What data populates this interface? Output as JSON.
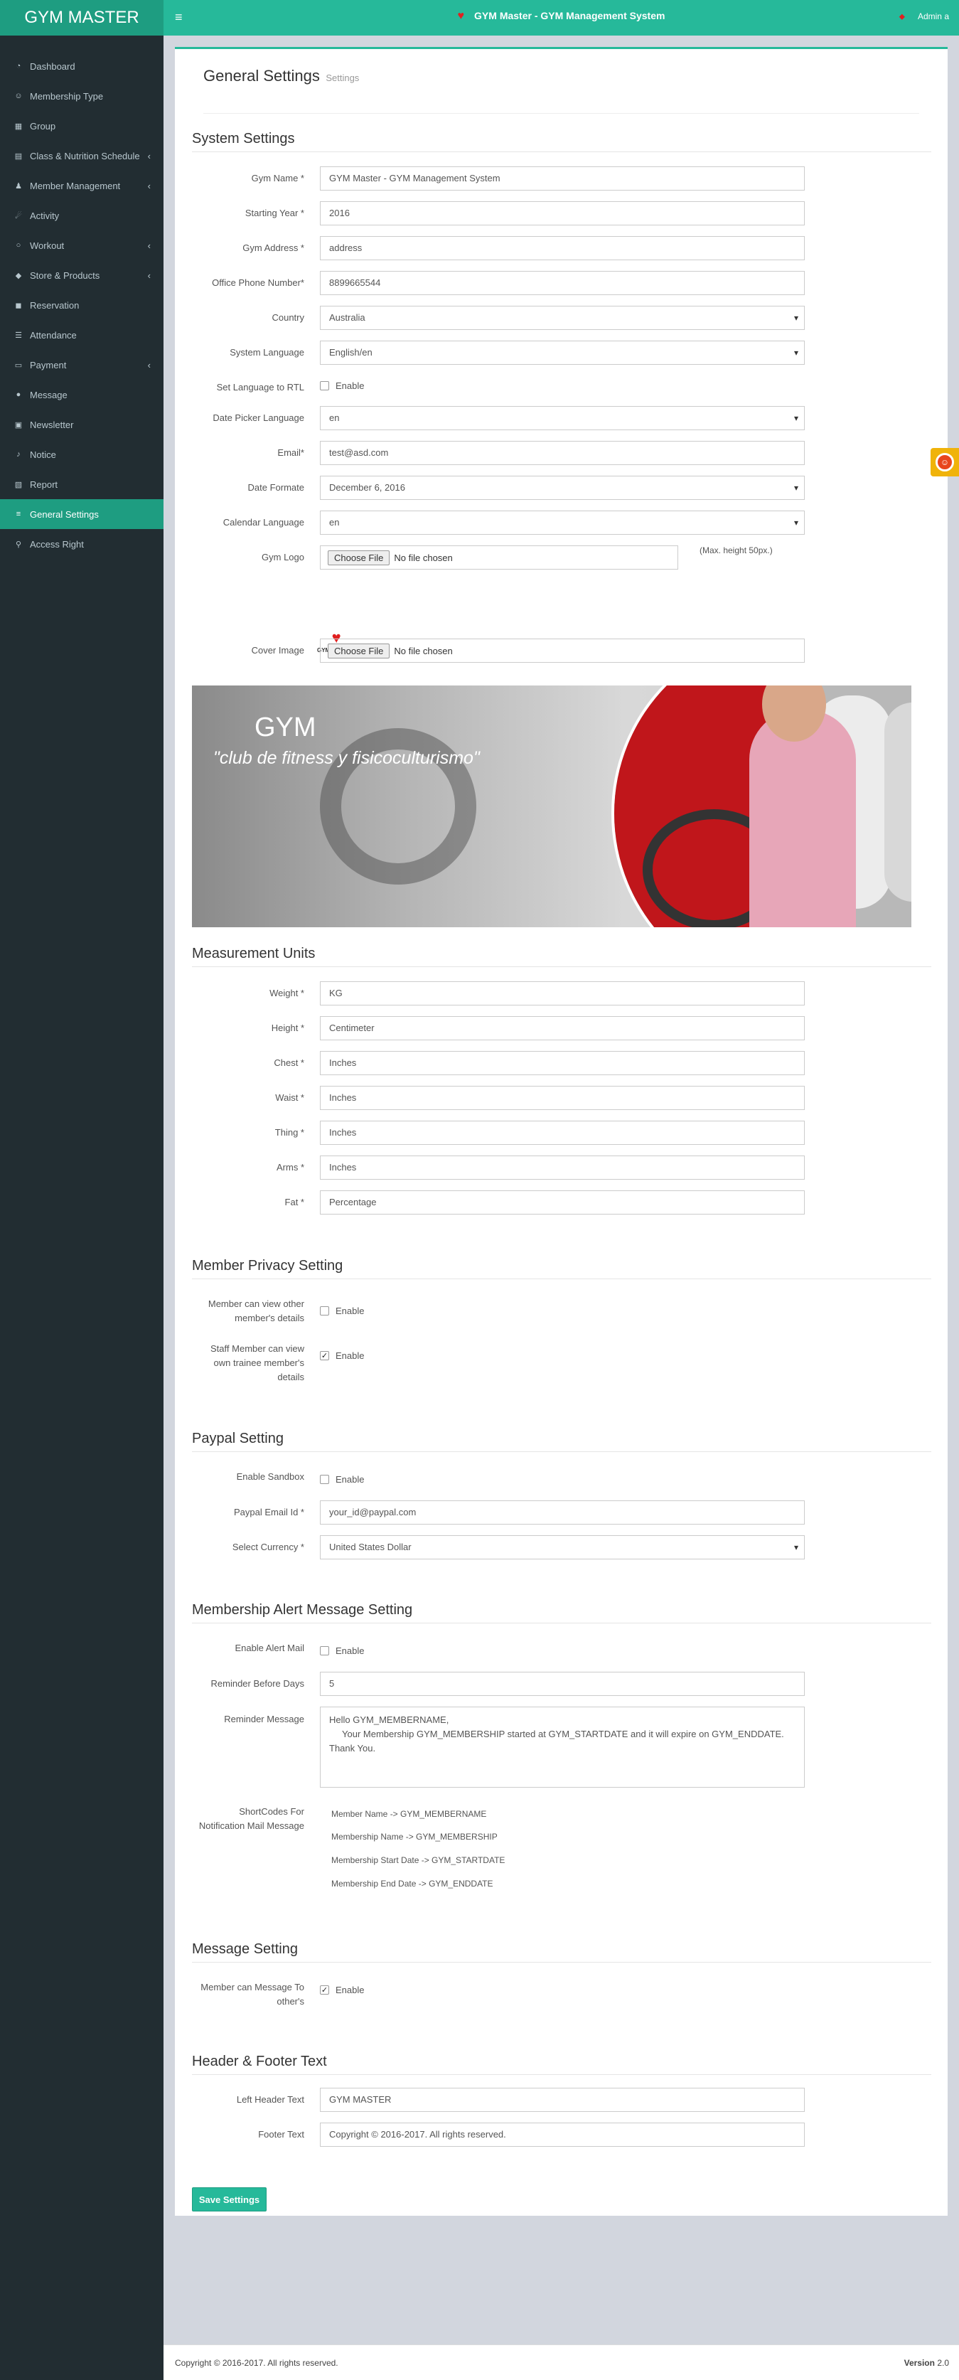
{
  "app": {
    "logo": "GYM MASTER",
    "title": "GYM Master - GYM Management System",
    "user": "Admin a"
  },
  "sidebar": {
    "items": [
      {
        "label": "Dashboard",
        "icon": "dashboard-icon"
      },
      {
        "label": "Membership Type",
        "icon": "users-icon"
      },
      {
        "label": "Group",
        "icon": "group-icon"
      },
      {
        "label": "Class & Nutrition Schedule",
        "icon": "calendar-icon",
        "chevron": true
      },
      {
        "label": "Member Management",
        "icon": "user-icon",
        "chevron": true
      },
      {
        "label": "Activity",
        "icon": "activity-icon"
      },
      {
        "label": "Workout",
        "icon": "workout-icon",
        "chevron": true
      },
      {
        "label": "Store & Products",
        "icon": "tag-icon",
        "chevron": true
      },
      {
        "label": "Reservation",
        "icon": "reservation-icon"
      },
      {
        "label": "Attendance",
        "icon": "attendance-icon"
      },
      {
        "label": "Payment",
        "icon": "payment-icon",
        "chevron": true
      },
      {
        "label": "Message",
        "icon": "message-icon"
      },
      {
        "label": "Newsletter",
        "icon": "newsletter-icon"
      },
      {
        "label": "Notice",
        "icon": "bell-icon"
      },
      {
        "label": "Report",
        "icon": "report-icon"
      },
      {
        "label": "General Settings",
        "icon": "settings-icon",
        "active": true
      },
      {
        "label": "Access Right",
        "icon": "key-icon"
      }
    ]
  },
  "page": {
    "title": "General Settings",
    "subtitle": "Settings"
  },
  "system": {
    "title": "System Settings",
    "gym_name_label": "Gym Name *",
    "gym_name": "GYM Master - GYM Management System",
    "year_label": "Starting Year *",
    "year": "2016",
    "address_label": "Gym Address *",
    "address": "address",
    "phone_label": "Office Phone Number*",
    "phone": "8899665544",
    "country_label": "Country",
    "country": "Australia",
    "lang_label": "System Language",
    "lang": "English/en",
    "rtl_label": "Set Language to RTL",
    "rtl_value": "Enable",
    "datepicker_label": "Date Picker Language",
    "datepicker": "en",
    "email_label": "Email*",
    "email": "test@asd.com",
    "dateformat_label": "Date Formate",
    "dateformat": "December 6, 2016",
    "calendar_label": "Calendar Language",
    "calendar": "en",
    "logo_label": "Gym Logo",
    "choose_file": "Choose File",
    "no_file": "No file chosen",
    "logo_hint": "(Max. height 50px.)",
    "logo_text": "GYM MASTER",
    "cover_label": "Cover Image",
    "banner_title": "GYM",
    "banner_tagline": "\"club de fitness y fisicoculturismo\""
  },
  "measurement": {
    "title": "Measurement Units",
    "rows": [
      {
        "label": "Weight *",
        "value": "KG"
      },
      {
        "label": "Height *",
        "value": "Centimeter"
      },
      {
        "label": "Chest *",
        "value": "Inches"
      },
      {
        "label": "Waist *",
        "value": "Inches"
      },
      {
        "label": "Thing *",
        "value": "Inches"
      },
      {
        "label": "Arms *",
        "value": "Inches"
      },
      {
        "label": "Fat *",
        "value": "Percentage"
      }
    ]
  },
  "privacy": {
    "title": "Member Privacy Setting",
    "member_view_label": "Member can view other member's details",
    "member_view": "Enable",
    "staff_view_label": "Staff Member can view own trainee member's details",
    "staff_view": "Enable"
  },
  "paypal": {
    "title": "Paypal Setting",
    "sandbox_label": "Enable Sandbox",
    "sandbox": "Enable",
    "email_label": "Paypal Email Id *",
    "email": "your_id@paypal.com",
    "currency_label": "Select Currency *",
    "currency": "United States Dollar"
  },
  "alert": {
    "title": "Membership Alert Message Setting",
    "mail_label": "Enable Alert Mail",
    "mail": "Enable",
    "days_label": "Reminder Before Days",
    "days": "5",
    "msg_label": "Reminder Message",
    "msg_line1": "Hello GYM_MEMBERNAME,",
    "msg_line2": "Your Membership  GYM_MEMBERSHIP  started at GYM_STARTDATE and it will expire on GYM_ENDDATE.",
    "msg_line3": "Thank You.",
    "shortcodes_label": "ShortCodes For Notification Mail Message",
    "shortcodes": [
      "Member Name -> GYM_MEMBERNAME",
      "Membership Name -> GYM_MEMBERSHIP",
      "Membership Start Date -> GYM_STARTDATE",
      "Membership End Date -> GYM_ENDDATE"
    ]
  },
  "message_setting": {
    "title": "Message Setting",
    "label": "Member can Message To other's",
    "value": "Enable"
  },
  "header_footer": {
    "title": "Header & Footer Text",
    "left_label": "Left Header Text",
    "left": "GYM MASTER",
    "footer_label": "Footer Text",
    "footer": "Copyright © 2016-2017. All rights reserved."
  },
  "save_label": "Save Settings",
  "footer": {
    "copyright": "Copyright © 2016-2017. All rights reserved.",
    "version_label": "Version",
    "version": "2.0"
  }
}
